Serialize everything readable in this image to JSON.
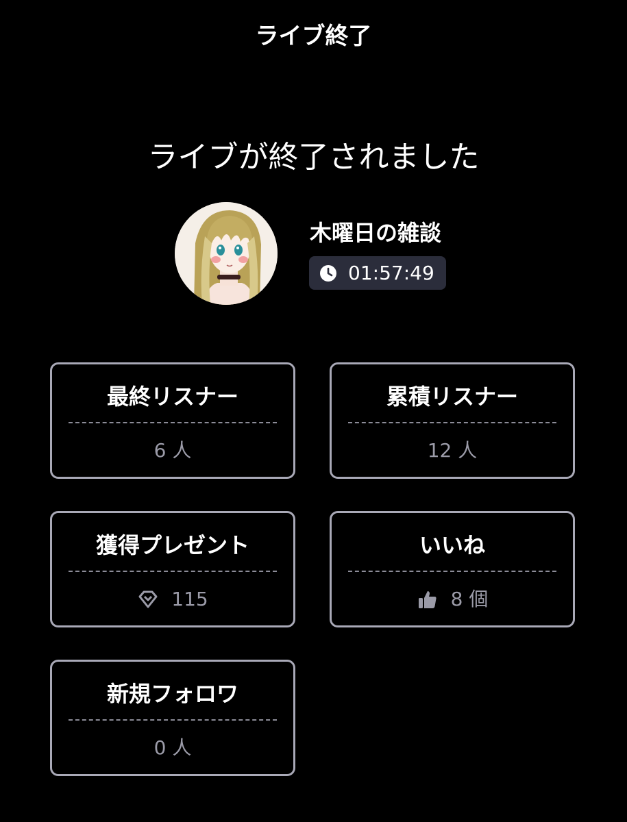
{
  "header": {
    "title": "ライブ終了"
  },
  "ended_message": "ライブが終了されました",
  "stream": {
    "title": "木曜日の雑談",
    "duration": "01:57:49",
    "duration_icon": "clock-icon",
    "avatar_icon": "avatar"
  },
  "colors": {
    "background": "#000000",
    "card_border": "#a9a9b7",
    "pill_bg": "#2b2d3b",
    "value_text": "#9b9ba8",
    "divider": "#8c8c98"
  },
  "stats": [
    {
      "title": "最終リスナー",
      "value": "6 人",
      "icon": null
    },
    {
      "title": "累積リスナー",
      "value": "12 人",
      "icon": null
    },
    {
      "title": "獲得プレゼント",
      "value": "115",
      "icon": "diamond-icon"
    },
    {
      "title": "いいね",
      "value": "8 個",
      "icon": "thumbs-up-icon"
    },
    {
      "title": "新規フォロワ",
      "value": "0 人",
      "icon": null
    }
  ]
}
